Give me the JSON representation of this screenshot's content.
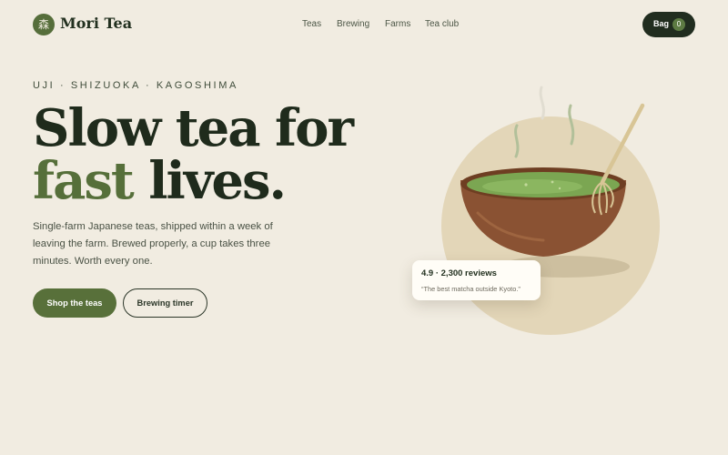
{
  "brand": {
    "name": "Mori Tea",
    "mark": "森"
  },
  "nav": {
    "items": [
      "Teas",
      "Brewing",
      "Farms",
      "Tea club"
    ]
  },
  "bag": {
    "label": "Bag",
    "count": "0"
  },
  "hero": {
    "eyebrow": "UJI · SHIZUOKA · KAGOSHIMA",
    "headline_line1": "Slow tea for",
    "headline_accent": "fast",
    "headline_rest": "lives.",
    "subtext": "Single-farm Japanese teas, shipped within a week of leaving the farm. Brewed properly, a cup takes three minutes. Worth every one.",
    "primary_cta": "Shop the teas",
    "secondary_cta": "Brewing timer"
  },
  "review": {
    "score": "4.9 · 2,300 reviews",
    "quote": "“The best matcha outside Kyoto.”"
  },
  "illustration": {
    "subject": "matcha-bowl-with-whisk-icon",
    "colors": {
      "backdrop": "#e3d6b8",
      "bowl": "#8a5233",
      "matcha": "#7ba652",
      "whisk": "#d8c596"
    }
  },
  "colors": {
    "background": "#f1ece1",
    "ink": "#1f2b1c",
    "accent": "#566f3a",
    "dark_button": "#212d1f"
  }
}
